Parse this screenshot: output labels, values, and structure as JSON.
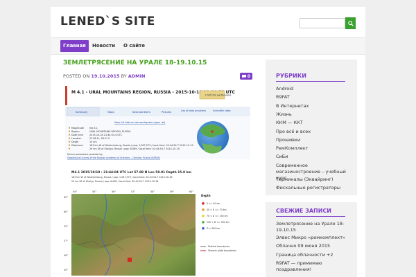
{
  "header": {
    "site_title": "LENED`S SITE",
    "search_placeholder": ""
  },
  "nav": {
    "items": [
      {
        "label": "Главная",
        "active": true
      },
      {
        "label": "Новости",
        "active": false
      },
      {
        "label": "О сайте",
        "active": false
      }
    ]
  },
  "post": {
    "title": "Землетрясение на Урале 18-19.10.15",
    "meta_prefix": "POSTED ON",
    "date": "19.10.2015",
    "by": "BY",
    "author": "ADMIN",
    "comment_count": "0"
  },
  "figure": {
    "quake_title": "M 4.1 - URAL MOUNTAINS REGION, RUSSIA - 2015-10-18 21:44:53 UTC",
    "felt_button": "I felt this earthquake",
    "tabs": [
      "Summary",
      "Maps",
      "Seismometers",
      "Pictures",
      "List of data providers",
      "Scientific data"
    ],
    "full_list_link": "View full data on the earthquake (open ref)",
    "fields": [
      {
        "label": "Magnitude",
        "value": "mb 4.1"
      },
      {
        "label": "Region",
        "value": "URAL MOUNTAINS REGION, RUSSIA"
      },
      {
        "label": "Date time",
        "value": "2015-10-18 21:44:53.4 UTC"
      },
      {
        "label": "Location",
        "value": "57.88 N ; 58.01 E"
      },
      {
        "label": "Depth",
        "value": "15 km"
      },
      {
        "label": "Distances",
        "value": "163 km W of Yekaterinburg, Russia / pop: 1,287,573 / local time: 02:44:54.7 2015-10-19"
      },
      {
        "label": "",
        "value": "29 km SE of Shaliya, Russia / pop: 6,089 / local time: 02:44:54.7 2015-10-19"
      }
    ],
    "source_label": "Source parameters provided by:",
    "source_link": "Geophysical Survey of the Russian Academy of Sciences -- Obninsk, Russia (GSRAS)",
    "map_header": "M4.1  2015/10/18 : 21:44:04 UTC  Lat  57.88 N  Lon  58.01  Depth  15.0 km",
    "map_sub1": "163 km W of Yekaterinburg, Russia / pop: 1,287,573 / local time: 02:44:54.7 2015-10-18",
    "map_sub2": "29 km SE of Shalya, Russia / pop: 6,089 / local time: 02:44:54.7 2015-10-18",
    "legend_title": "Depth",
    "legend": [
      "0 <= 40 km",
      "40 < D <= 70 km",
      "70 < D <= 150 km",
      "150 < D <= 300 km",
      "D > 300 km"
    ],
    "boundaries": [
      "Political boundaries",
      "Tectonic plate boundaries"
    ],
    "lat_ticks": [
      "62°",
      "60°",
      "59°",
      "57°",
      "56°",
      "55°"
    ],
    "lon_ticks": [
      "54°",
      "55°",
      "56°",
      "57°",
      "58°",
      "59°",
      "60°"
    ]
  },
  "sidebar": {
    "rubrics_title": "Рубрики",
    "rubrics": [
      "Android",
      "R9FAT",
      "В Интернетах",
      "Жизнь",
      "ККМ — ККТ",
      "Про всё и всех",
      "Прошивки",
      "РемКомплект",
      "СиБи",
      "Современное магазиностроение – учебный курс",
      "Терминалы (Эквайринг)",
      "Фискальные регистраторы"
    ],
    "recent_title": "Свежие записи",
    "recent": [
      "Землетрясение на Урале 18-19.10.15",
      "Элвес Микро «ремкомплект»",
      "Облачно 09 июня 2015",
      "Граница облачности +2",
      "R9FAT — примимаю поздравления!"
    ]
  },
  "colors": {
    "accent_purple": "#7e3ec9",
    "title_green": "#46a11e",
    "search_green": "#3aa12f"
  }
}
